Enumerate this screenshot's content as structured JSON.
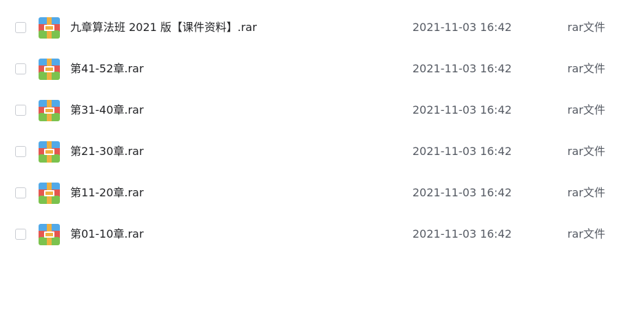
{
  "file_icon": "rar-archive-icon",
  "colors": {
    "icon_blue": "#52a9e8",
    "icon_red": "#e45750",
    "icon_green": "#7bc24e",
    "icon_strap": "#f0b040",
    "text_primary": "#222326",
    "text_secondary": "#555a63",
    "checkbox_border": "#c9ccd2"
  },
  "files": [
    {
      "name": "九章算法班 2021 版【课件资料】.rar",
      "modified": "2021-11-03 16:42",
      "type": "rar文件"
    },
    {
      "name": "第41-52章.rar",
      "modified": "2021-11-03 16:42",
      "type": "rar文件"
    },
    {
      "name": "第31-40章.rar",
      "modified": "2021-11-03 16:42",
      "type": "rar文件"
    },
    {
      "name": "第21-30章.rar",
      "modified": "2021-11-03 16:42",
      "type": "rar文件"
    },
    {
      "name": "第11-20章.rar",
      "modified": "2021-11-03 16:42",
      "type": "rar文件"
    },
    {
      "name": "第01-10章.rar",
      "modified": "2021-11-03 16:42",
      "type": "rar文件"
    }
  ]
}
